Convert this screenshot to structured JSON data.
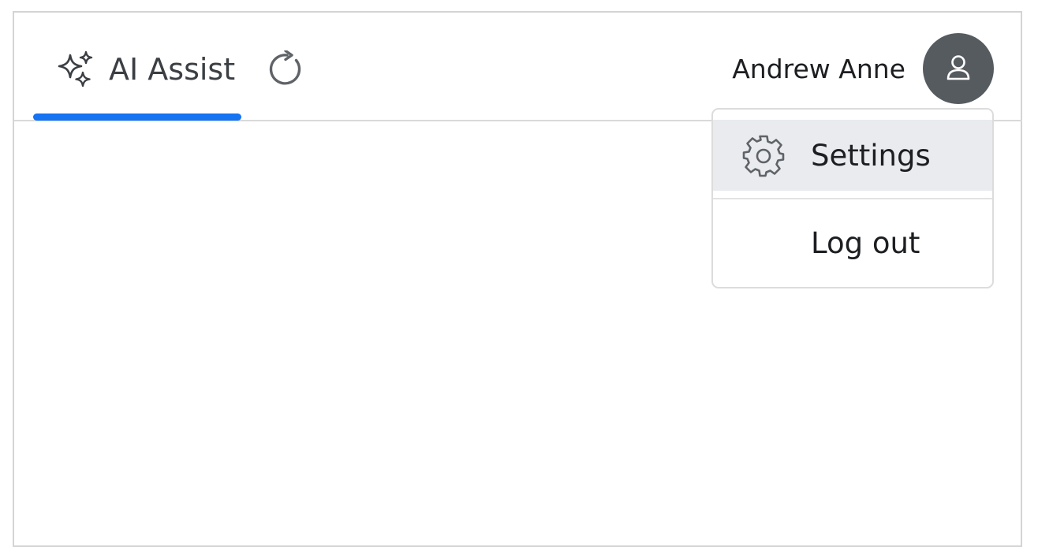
{
  "header": {
    "tabs": [
      {
        "label": "AI Assist",
        "icon": "sparkles-icon",
        "active": true
      }
    ],
    "refresh_icon": "refresh-icon",
    "user": {
      "name": "Andrew Anne",
      "avatar_icon": "user-icon"
    }
  },
  "user_menu": {
    "items": [
      {
        "label": "Settings",
        "icon": "gear-icon",
        "highlighted": true
      },
      {
        "label": "Log out"
      }
    ]
  },
  "colors": {
    "accent": "#1673f2",
    "avatar_bg": "#565b60",
    "menu_hover_bg": "#e9ebee",
    "border": "#d4d4d4"
  }
}
